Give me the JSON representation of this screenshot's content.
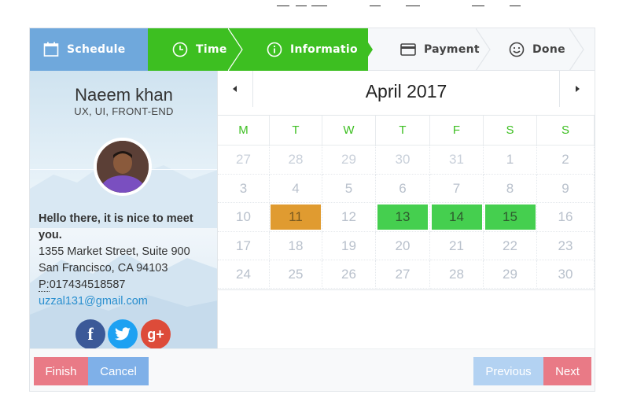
{
  "steps": [
    {
      "label": "Schedule",
      "icon": "calendar-icon"
    },
    {
      "label": "Time",
      "icon": "clock-icon"
    },
    {
      "label": "Information",
      "icon": "info-icon"
    },
    {
      "label": "Payment",
      "icon": "credit-card-icon"
    },
    {
      "label": "Done",
      "icon": "smiley-icon"
    }
  ],
  "profile": {
    "name": "Naeem khan",
    "role": "UX, UI, FRONT-END",
    "greeting": "Hello there, it is nice to meet you.",
    "address_line1": "1355 Market Street, Suite 900",
    "address_line2": "San Francisco, CA 94103",
    "phone_label": "P:",
    "phone": "017434518587",
    "email": "uzzal131@gmail.com",
    "social": [
      {
        "name": "facebook-icon",
        "glyph": "f"
      },
      {
        "name": "twitter-icon",
        "glyph": ""
      },
      {
        "name": "google-plus-icon",
        "glyph": "g+"
      }
    ]
  },
  "calendar": {
    "month": "April",
    "year": "2017",
    "weekdays": [
      "M",
      "T",
      "W",
      "T",
      "F",
      "S",
      "S"
    ],
    "weeks": [
      [
        "27",
        "28",
        "29",
        "30",
        "31",
        "1",
        "2"
      ],
      [
        "3",
        "4",
        "5",
        "6",
        "7",
        "8",
        "9"
      ],
      [
        "10",
        "11",
        "12",
        "13",
        "14",
        "15",
        "16"
      ],
      [
        "17",
        "18",
        "19",
        "20",
        "21",
        "22",
        "23"
      ],
      [
        "24",
        "25",
        "26",
        "27",
        "28",
        "29",
        "30"
      ]
    ],
    "selected_orange": [
      "11"
    ],
    "selected_green": [
      "13",
      "14",
      "15"
    ]
  },
  "buttons": {
    "finish": "Finish",
    "cancel": "Cancel",
    "previous": "Previous",
    "next": "Next"
  },
  "colors": {
    "schedule": "#6fa8dc",
    "active_green": "#3dbf21",
    "orange_day": "#e09b30",
    "green_day": "#45cf4f",
    "email": "#2a8fcf",
    "finish": "#e97a86",
    "cancel": "#7fb0e8",
    "previous": "#b3d2f2",
    "next": "#e97a86"
  }
}
